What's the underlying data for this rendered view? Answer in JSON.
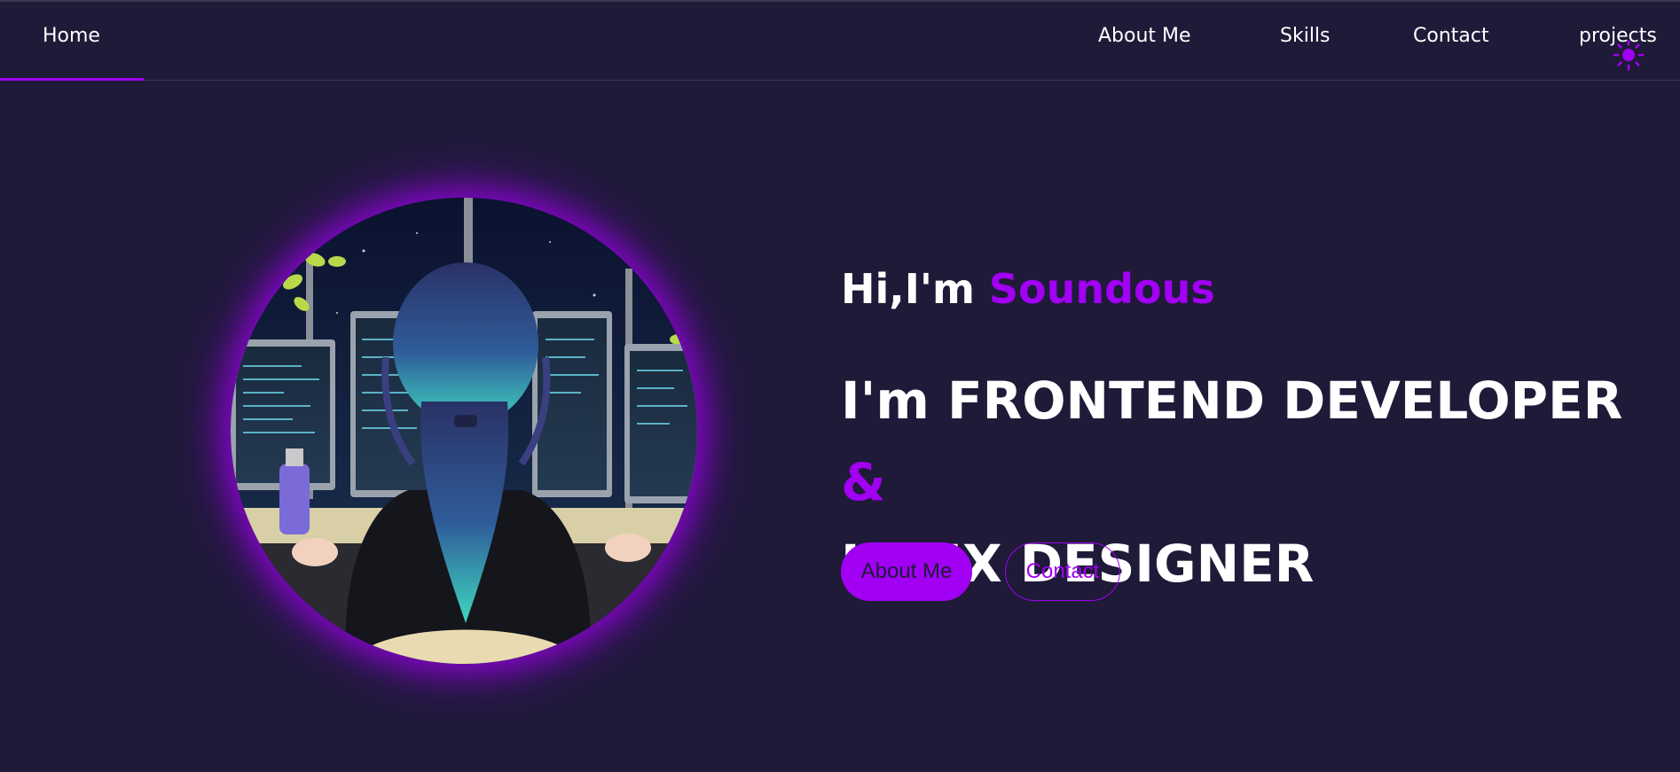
{
  "nav": {
    "home": "Home",
    "about": "About Me",
    "skills": "Skills",
    "contact": "Contact",
    "projects": "projects",
    "theme_toggle_icon": "sun-icon"
  },
  "hero": {
    "greeting_prefix": "Hi,I'm ",
    "name": "Soundous",
    "role_line1": "I'm FRONTEND DEVELOPER ",
    "role_amp": "&",
    "role_line2": "UI/UX DESIGNER",
    "avatar_icon": "developer-avatar-illustration"
  },
  "buttons": {
    "about": "About Me",
    "contact": "Contact"
  },
  "colors": {
    "background": "#1e1a38",
    "accent": "#a100f2",
    "text": "#ffffff"
  }
}
